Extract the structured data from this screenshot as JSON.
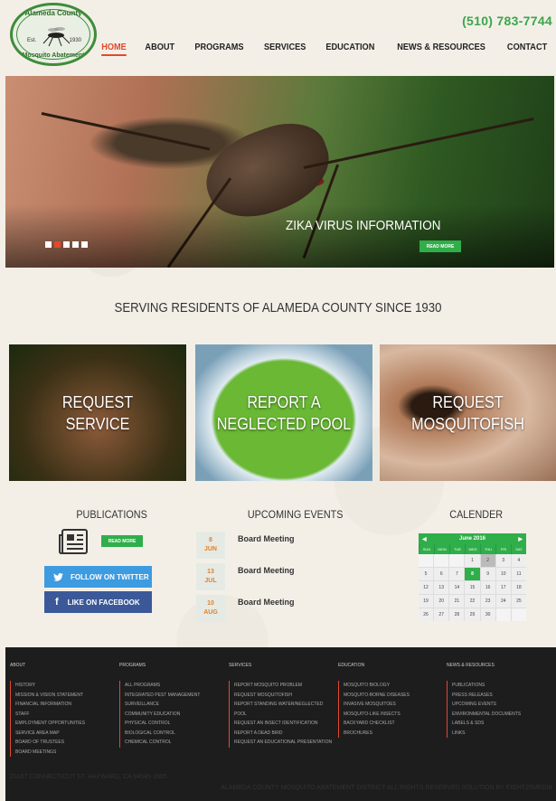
{
  "header": {
    "logo": {
      "top_text": "Alameda County",
      "bottom_text": "Mosquito Abatement",
      "est": "Est.",
      "year": "1930"
    },
    "phone": "(510) 783-7744",
    "nav": [
      "HOME",
      "ABOUT",
      "PROGRAMS",
      "SERVICES",
      "EDUCATION",
      "NEWS & RESOURCES",
      "CONTACT"
    ],
    "active_nav": "HOME"
  },
  "hero": {
    "title": "ZIKA VIRUS INFORMATION",
    "button": "READ MORE",
    "slide_count": 5,
    "active_slide": 2
  },
  "main": {
    "section_title": "SERVING RESIDENTS OF ALAMEDA COUNTY SINCE 1930",
    "cards": [
      {
        "line1": "REQUEST",
        "line2": "SERVICE"
      },
      {
        "line1": "REPORT A",
        "line2": "NEGLECTED POOL"
      },
      {
        "line1": "REQUEST",
        "line2": "MOSQUITOFISH"
      }
    ],
    "publications": {
      "title": "PUBLICATIONS",
      "button": "READ MORE",
      "twitter": "FOLLOW ON TWITTER",
      "facebook": "LIKE ON FACEBOOK"
    },
    "events": {
      "title": "UPCOMING EVENTS",
      "items": [
        {
          "day": "8",
          "month": "JUN",
          "name": "Board Meeting"
        },
        {
          "day": "13",
          "month": "JUL",
          "name": "Board Meeting"
        },
        {
          "day": "10",
          "month": "AUG",
          "name": "Board Meeting"
        }
      ]
    },
    "calendar": {
      "title": "CALENDER",
      "month": "June 2016",
      "days": [
        "SUN",
        "MON",
        "TUE",
        "WED",
        "THU",
        "FRI",
        "SAT"
      ],
      "weeks": [
        [
          "",
          "",
          "",
          "1",
          "2",
          "3",
          "4"
        ],
        [
          "5",
          "6",
          "7",
          "8",
          "9",
          "10",
          "11"
        ],
        [
          "12",
          "13",
          "14",
          "15",
          "16",
          "17",
          "18"
        ],
        [
          "19",
          "20",
          "21",
          "22",
          "23",
          "24",
          "25"
        ],
        [
          "26",
          "27",
          "28",
          "29",
          "30",
          "",
          ""
        ]
      ],
      "today": "8",
      "selected": "2"
    }
  },
  "footer": {
    "columns": [
      {
        "title": "ABOUT",
        "items": [
          "HISTORY",
          "MISSION & VISION STATEMENT",
          "FINANCIAL INFORMATION",
          "STAFF",
          "EMPLOYMENT OPPORTUNITIES",
          "SERVICE AREA MAP",
          "BOARD OF TRUSTEES",
          "BOARD MEETINGS"
        ]
      },
      {
        "title": "PROGRAMS",
        "items": [
          "ALL PROGRAMS",
          "INTEGRATED PEST MANAGEMENT",
          "SURVEILLANCE",
          "COMMUNITY EDUCATION",
          "PHYSICAL CONTROL",
          "BIOLOGICAL CONTROL",
          "CHEMICAL CONTROL"
        ]
      },
      {
        "title": "SERVICES",
        "items": [
          "REPORT MOSQUITO PROBLEM",
          "REQUEST MOSQUITOFISH",
          "REPORT STANDING WATER/NEGLECTED POOL",
          "REQUEST AN INSECT IDENTIFICATION",
          "REPORT A DEAD BIRD",
          "REQUEST AN EDUCATIONAL PRESENTATION"
        ]
      },
      {
        "title": "EDUCATION",
        "items": [
          "MOSQUITO BIOLOGY",
          "MOSQUITO-BORNE DISEASES",
          "INVASIVE MOSQUITOES",
          "MOSQUITO-LIKE INSECTS",
          "BACKYARD CHECKLIST",
          "BROCHURES"
        ]
      },
      {
        "title": "NEWS & RESOURCES",
        "items": [
          "PUBLICATIONS",
          "PRESS RELEASES",
          "UPCOMING EVENTS",
          "ENVIRONMENTAL DOCUMENTS",
          "LABELS & SDS",
          "LINKS"
        ]
      }
    ],
    "address": "23187 CONNECTICUT ST. HAYWARD, CA 94545-1605",
    "copyright": "ALAMEDA COUNTY MOSQUITO ABATEMENT DISTRICT ALL RIGHTS RESERVED SOLUTION BY EIGHT25MEDIA"
  }
}
